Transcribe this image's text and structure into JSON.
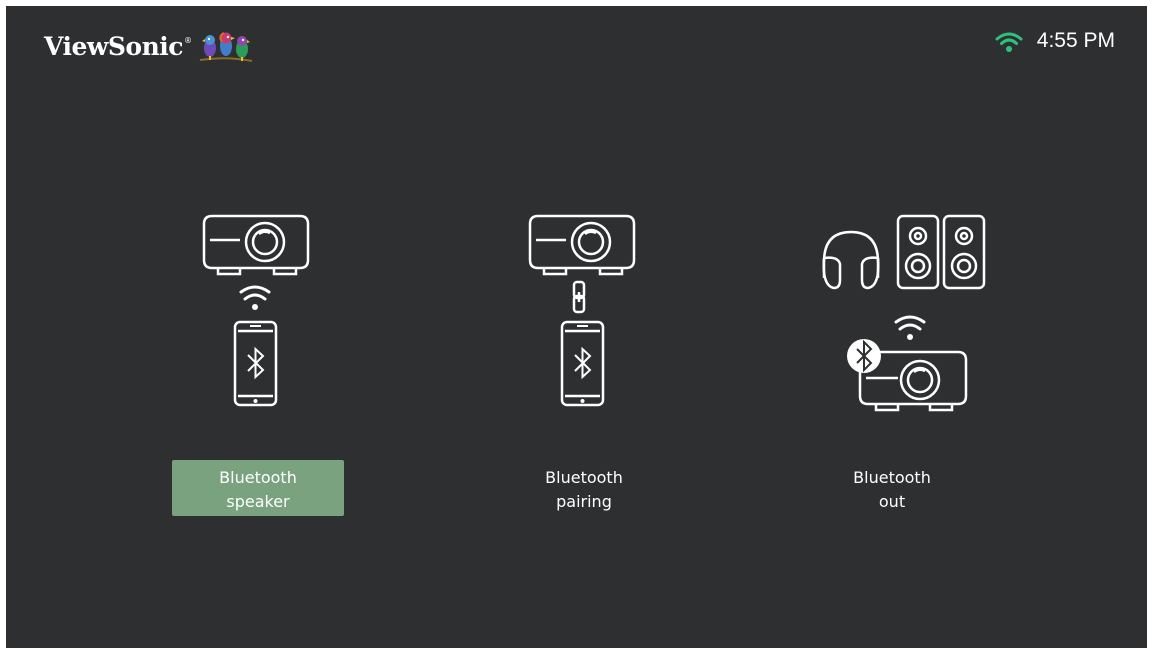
{
  "brand": {
    "name": "ViewSonic",
    "trademark": "®"
  },
  "status_bar": {
    "time": "4:55 PM",
    "wifi_icon": "wifi-icon",
    "wifi_color": "#2ec27e"
  },
  "options": [
    {
      "line1": "Bluetooth",
      "line2": "speaker",
      "selected": true,
      "icons": [
        "projector-icon",
        "wifi-icon",
        "phone-bluetooth-icon"
      ]
    },
    {
      "line1": "Bluetooth",
      "line2": "pairing",
      "selected": false,
      "icons": [
        "projector-icon",
        "link-icon",
        "phone-bluetooth-icon"
      ]
    },
    {
      "line1": "Bluetooth",
      "line2": "out",
      "selected": false,
      "icons": [
        "headphones-icon",
        "speakers-icon",
        "wifi-icon",
        "bluetooth-icon",
        "projector-icon"
      ]
    }
  ],
  "colors": {
    "background": "#2e2f30",
    "selected": "#7aa27f",
    "icon_stroke": "#ffffff"
  }
}
